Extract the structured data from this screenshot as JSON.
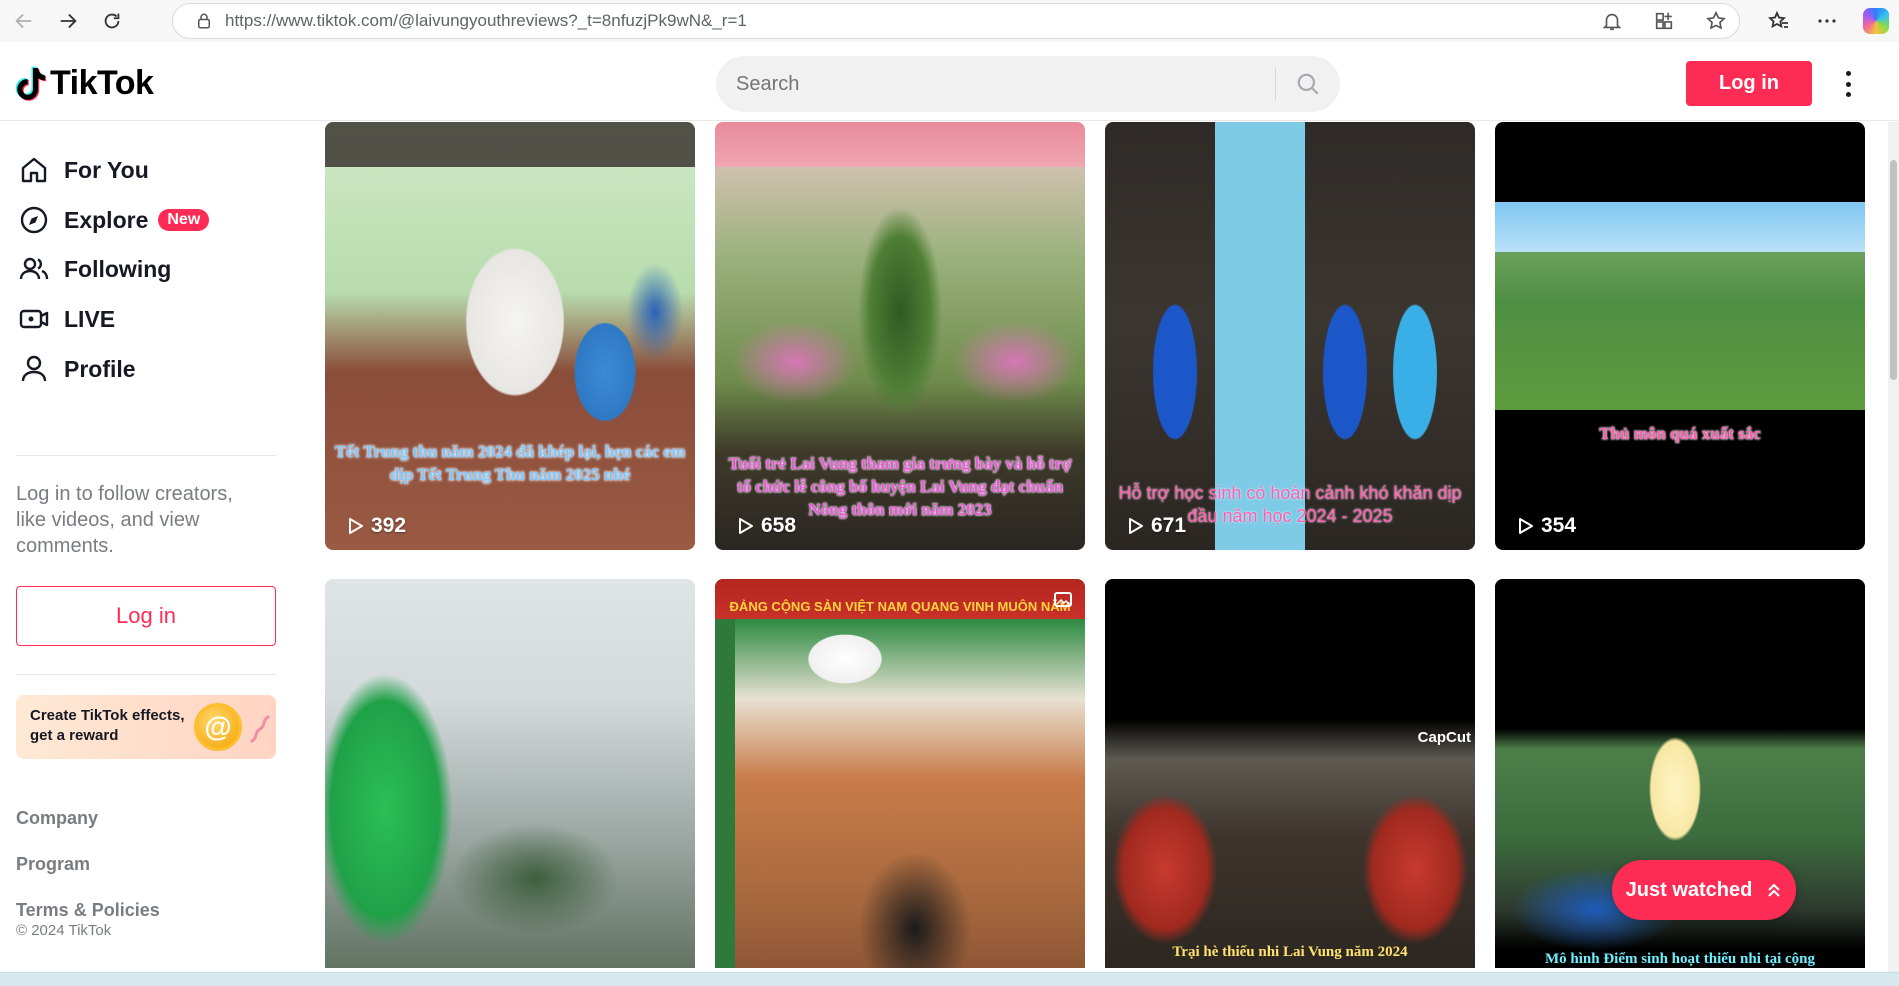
{
  "browser": {
    "url_path": "https://www.tiktok.com/@laivungyouthreviews?_t=8nfuzjPk9wN&_r=1",
    "icons": [
      "back-icon",
      "forward-icon",
      "refresh-icon",
      "lock-icon",
      "bell-icon",
      "apps-icon",
      "star-icon",
      "favorites-icon",
      "more-icon",
      "copilot-icon"
    ]
  },
  "header": {
    "logo_text": "TikTok",
    "search_placeholder": "Search",
    "login_label": "Log in"
  },
  "sidebar": {
    "nav": [
      {
        "label": "For You",
        "icon": "home-icon"
      },
      {
        "label": "Explore",
        "icon": "compass-icon",
        "badge": "New"
      },
      {
        "label": "Following",
        "icon": "users-icon"
      },
      {
        "label": "LIVE",
        "icon": "live-icon"
      },
      {
        "label": "Profile",
        "icon": "person-icon"
      }
    ],
    "login_hint": "Log in to follow creators, like videos, and view comments.",
    "login_label": "Log in",
    "promo_line1": "Create TikTok effects,",
    "promo_line2": "get a reward",
    "footer": [
      "Company",
      "Program",
      "Terms & Policies"
    ],
    "copyright": "© 2024 TikTok"
  },
  "videos": [
    {
      "caption": "Tết Trung thu năm 2024 đã khép lại,  hẹn các em dịp Tết Trung Thu năm 2025 nhé",
      "views": "392"
    },
    {
      "caption": "Tuổi trẻ Lai Vung tham gia trưng bày và hỗ trợ tổ chức lễ công bố huyện Lai Vung đạt chuẩn Nông thôn mới năm 2023",
      "views": "658"
    },
    {
      "caption": "Hỗ trợ học sinh có hoàn cảnh khó khăn dịp đầu năm học 2024 - 2025",
      "views": "671"
    },
    {
      "caption": "Thủ môn quá xuất sắc",
      "views": "354"
    },
    {
      "caption": "",
      "views": ""
    },
    {
      "caption": "ĐẢNG CỘNG SẢN VIỆT NAM QUANG VINH MUÔN NĂM",
      "views": ""
    },
    {
      "caption": "Trại hè thiếu nhi Lai Vung năm 2024",
      "views": "",
      "watermark": "CapCut"
    },
    {
      "caption": "Mô hình Điểm sinh hoạt thiếu nhi tại cộng",
      "views": ""
    }
  ],
  "just_watched_label": "Just watched",
  "colors": {
    "brand": "#fe2c55",
    "text": "#161823",
    "muted": "#7b7c82"
  }
}
